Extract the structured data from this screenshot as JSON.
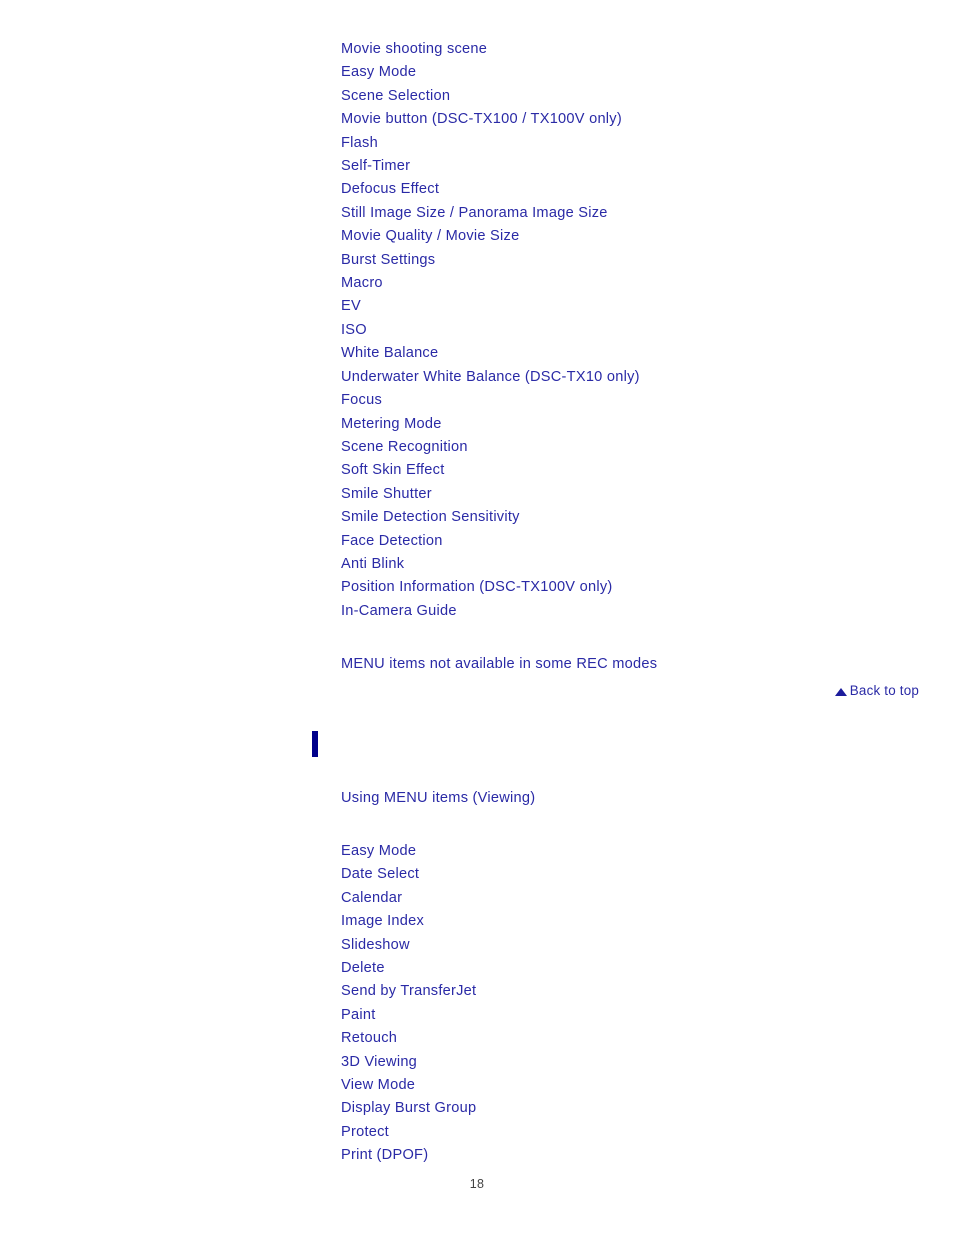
{
  "page": {
    "number": "18",
    "text_color": "#2a2aa6",
    "marker_color": "#00008b",
    "background": "#ffffff"
  },
  "rec_menu_section": {
    "items": [
      {
        "label": "Movie shooting scene"
      },
      {
        "label": "Easy Mode"
      },
      {
        "label": "Scene Selection"
      },
      {
        "label": "Movie button (DSC-TX100 / TX100V only)"
      },
      {
        "label": "Flash"
      },
      {
        "label": "Self-Timer"
      },
      {
        "label": "Defocus Effect"
      },
      {
        "label": "Still Image Size / Panorama Image Size"
      },
      {
        "label": "Movie Quality / Movie Size"
      },
      {
        "label": "Burst Settings"
      },
      {
        "label": "Macro"
      },
      {
        "label": "EV"
      },
      {
        "label": "ISO"
      },
      {
        "label": "White Balance"
      },
      {
        "label": "Underwater White Balance (DSC-TX10 only)"
      },
      {
        "label": "Focus"
      },
      {
        "label": "Metering Mode"
      },
      {
        "label": "Scene Recognition"
      },
      {
        "label": "Soft Skin Effect"
      },
      {
        "label": "Smile Shutter"
      },
      {
        "label": "Smile Detection Sensitivity"
      },
      {
        "label": "Face Detection"
      },
      {
        "label": "Anti Blink"
      },
      {
        "label": "Position Information (DSC-TX100V only)"
      },
      {
        "label": "In-Camera Guide"
      }
    ],
    "footer_link": "MENU items not available in some REC modes"
  },
  "back_to_top": {
    "label": "Back to top",
    "icon": "triangle-up-icon"
  },
  "viewing_menu_section": {
    "heading_link": "Using MENU items (Viewing)",
    "items": [
      {
        "label": "Easy Mode"
      },
      {
        "label": "Date Select"
      },
      {
        "label": "Calendar"
      },
      {
        "label": "Image Index"
      },
      {
        "label": "Slideshow"
      },
      {
        "label": "Delete"
      },
      {
        "label": "Send by TransferJet"
      },
      {
        "label": "Paint"
      },
      {
        "label": "Retouch"
      },
      {
        "label": "3D Viewing"
      },
      {
        "label": "View Mode"
      },
      {
        "label": "Display Burst Group"
      },
      {
        "label": "Protect"
      },
      {
        "label": "Print (DPOF)"
      }
    ]
  }
}
